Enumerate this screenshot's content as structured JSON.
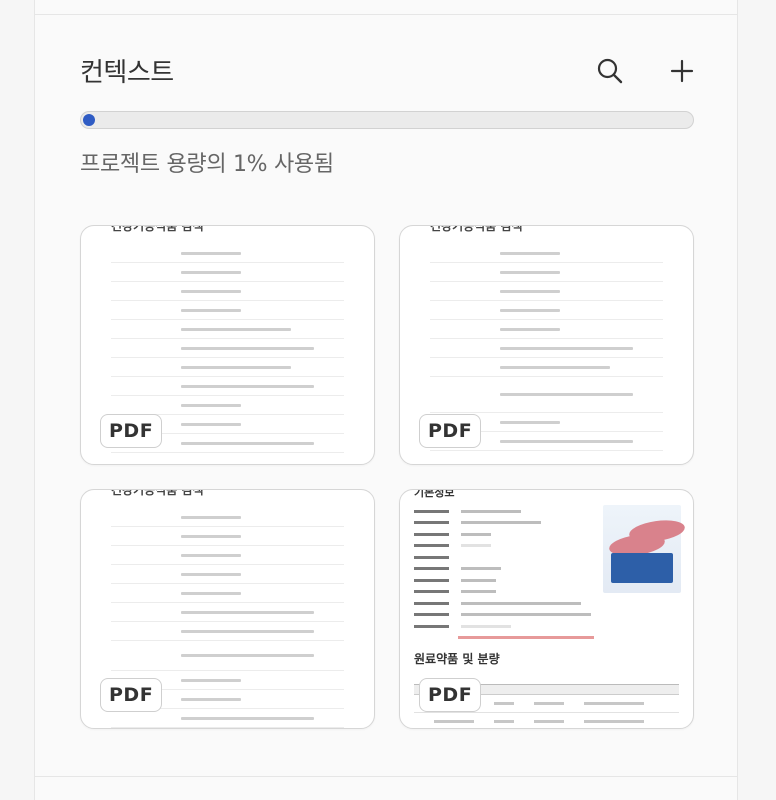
{
  "header": {
    "title": "컨텍스트",
    "search_icon": "search-icon",
    "add_icon": "plus-icon"
  },
  "usage": {
    "progress_percent": 1,
    "text": "프로젝트 용량의 1% 사용됨",
    "accent_color": "#2f5cc4"
  },
  "files": [
    {
      "type_label": "PDF",
      "preview_title": "건강기능식품 검색",
      "preview_kind": "table-document"
    },
    {
      "type_label": "PDF",
      "preview_title": "건강기능식품 검색",
      "preview_kind": "table-document"
    },
    {
      "type_label": "PDF",
      "preview_title": "건강기능식품 검색",
      "preview_kind": "table-document"
    },
    {
      "type_label": "PDF",
      "preview_title": "기본정보",
      "preview_kind": "drug-info",
      "section_title": "원료약품 및 분량"
    }
  ]
}
